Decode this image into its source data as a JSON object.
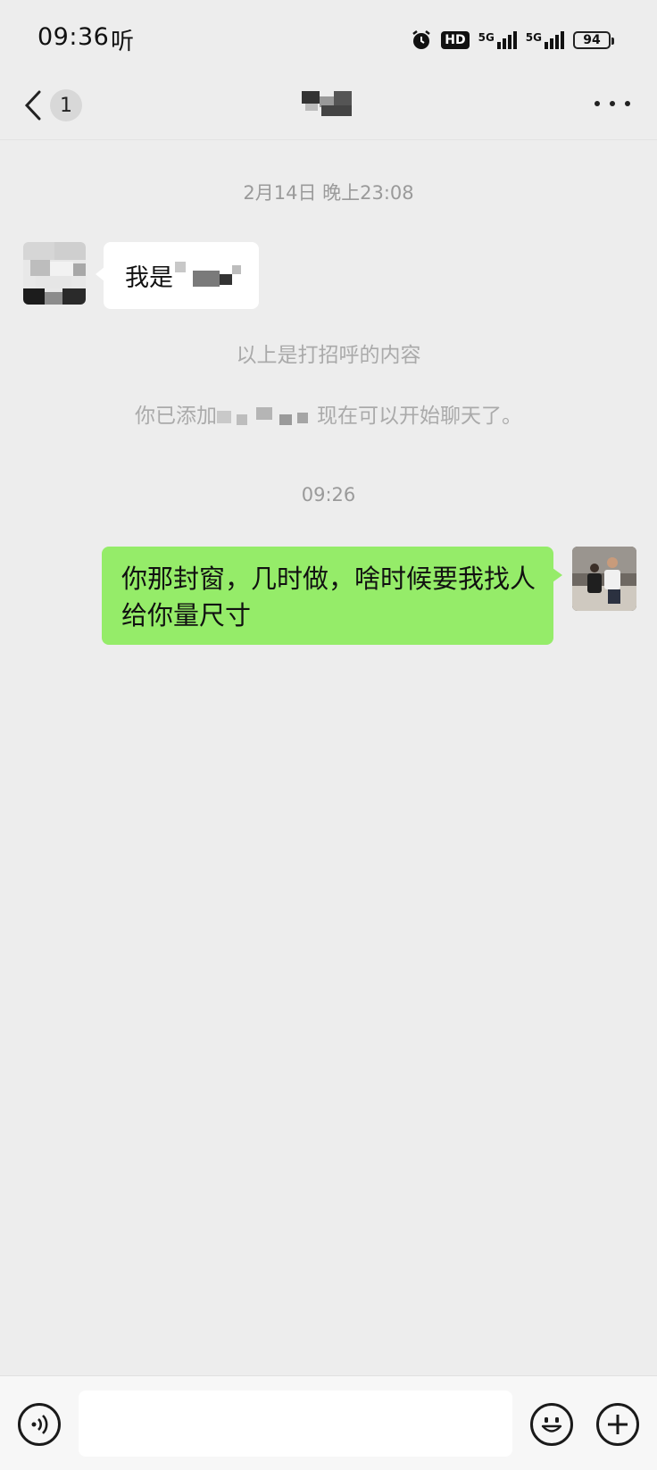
{
  "status_bar": {
    "time": "09:36",
    "app_indicator": "听",
    "hd_label": "HD",
    "network_1": "5G",
    "network_2": "5G",
    "battery": "94"
  },
  "nav": {
    "unread_count": "1"
  },
  "chat": {
    "timestamp_1": "2月14日 晚上23:08",
    "greeting_message": "我是",
    "greeting_note": "以上是打招呼的内容",
    "added_notice_prefix": "你已添加",
    "added_notice_suffix": "现在可以开始聊天了。",
    "timestamp_2": "09:26",
    "outgoing_message": "你那封窗，几时做，啥时候要我找人给你量尺寸"
  },
  "input": {
    "placeholder": ""
  },
  "colors": {
    "background": "#ededed",
    "outgoing_bubble": "#95ec69",
    "incoming_bubble": "#ffffff",
    "system_text": "#aaaaaa"
  },
  "icons": [
    "back-arrow-icon",
    "more-icon",
    "alarm-icon",
    "voice-icon",
    "emoji-icon",
    "plus-icon"
  ]
}
